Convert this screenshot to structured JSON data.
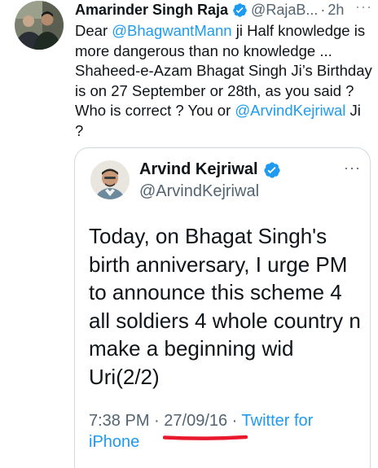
{
  "tweet": {
    "author_name": "Amarinder Singh Raja",
    "author_handle": "@RajaB...",
    "separator": "·",
    "time": "2h",
    "more": "···",
    "body": {
      "p1": "Dear ",
      "mention1": "@BhagwantMann",
      "p2": " ji Half knowledge is more dangerous than no knowledge ... Shaheed-e-Azam Bhagat Singh Ji’s Birthday is on 27 September or 28th, as you said ? Who is correct ? You or ",
      "mention2": "@ArvindKejriwal",
      "p3": " Ji ?"
    }
  },
  "quoted": {
    "author_name": "Arvind Kejriwal",
    "author_handle": "@ArvindKejriwal",
    "more": "···",
    "text": "Today, on Bhagat Singh's birth anniversary, I urge PM to announce this scheme 4 all soldiers 4 whole country n make a beginning wid Uri(2/2)",
    "time": "7:38 PM",
    "separator1": " · ",
    "date": "27/09/16",
    "separator2": " · ",
    "source": "Twitter for iPhone"
  },
  "colors": {
    "link": "#1d9bf0",
    "verified": "#1d9bf0",
    "annotation": "#e8192c"
  }
}
